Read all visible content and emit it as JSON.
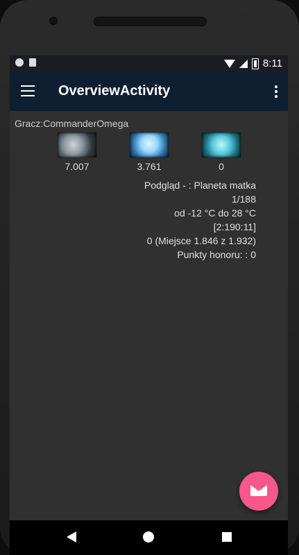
{
  "status_bar": {
    "time": "8:11"
  },
  "toolbar": {
    "title": "OverviewActivity"
  },
  "content": {
    "player": "Gracz:CommanderOmega",
    "resources": [
      {
        "icon": "metal-icon",
        "value": "7.007"
      },
      {
        "icon": "crystal-icon",
        "value": "3.761"
      },
      {
        "icon": "deuterium-icon",
        "value": "0"
      }
    ],
    "info_lines": [
      "Podgląd - : Planeta matka",
      "1/188",
      "od -12 °C do 28 °C",
      "[2:190:11]",
      "0 (Miejsce 1.846 z 1.932)",
      "Punkty honoru: : 0"
    ]
  },
  "fab": {
    "icon": "mail-icon"
  },
  "colors": {
    "toolbar_bg": "#0f1e31",
    "screen_bg": "#303030",
    "fab_bg": "#f7578a"
  }
}
